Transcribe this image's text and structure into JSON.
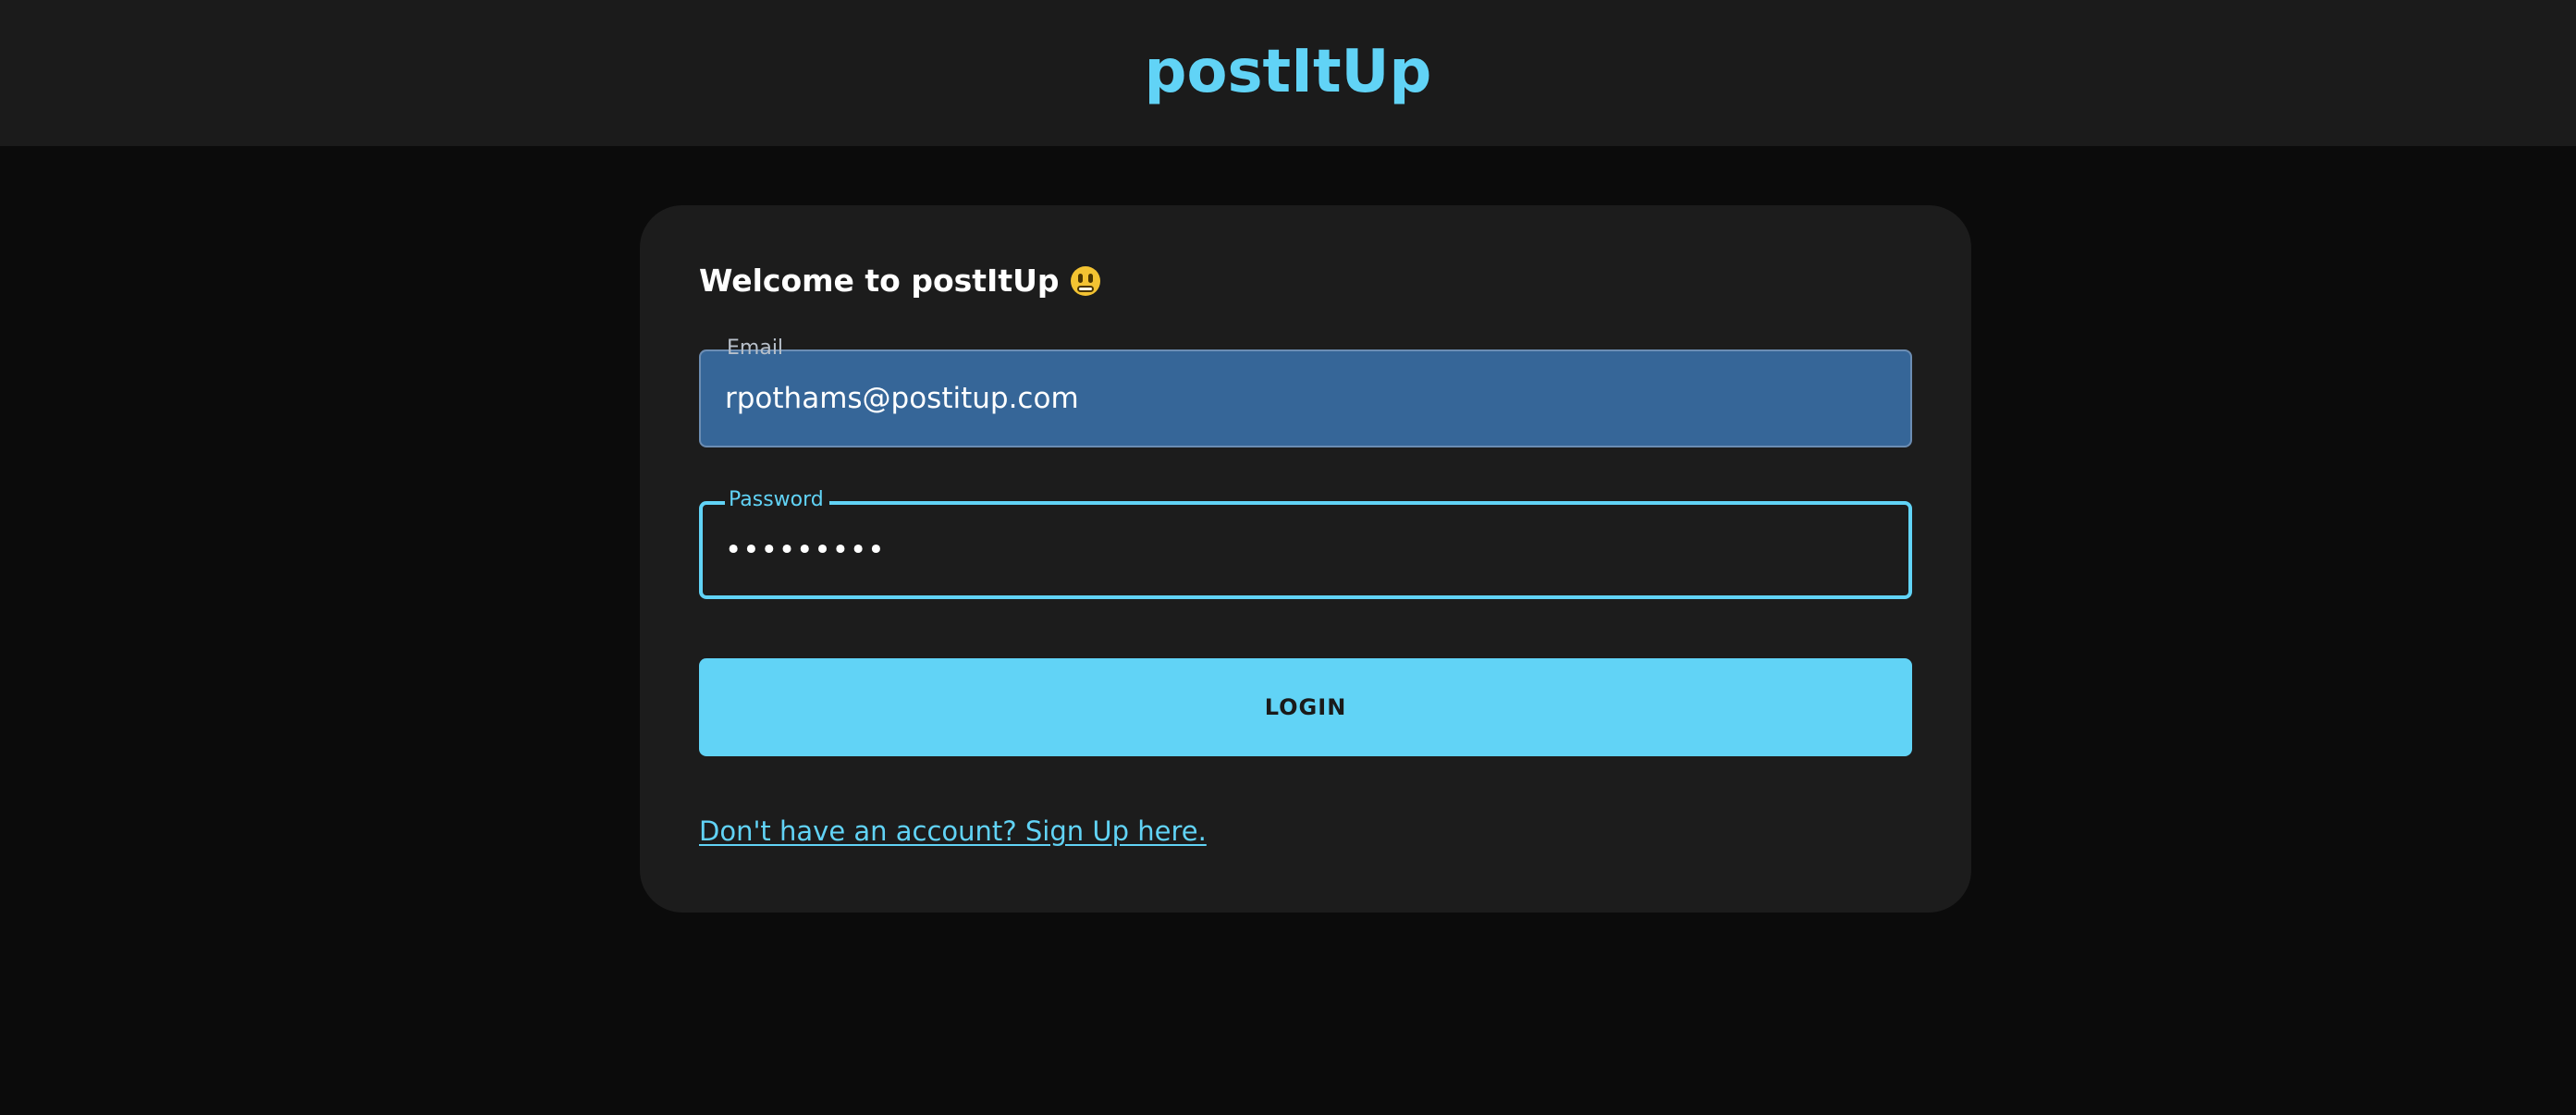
{
  "header": {
    "brand": "postItUp"
  },
  "login_card": {
    "welcome_text": "Welcome to postItUp",
    "emoji_name": "grimacing-face-icon",
    "email": {
      "label": "Email",
      "value": "rpothams@postitup.com"
    },
    "password": {
      "label": "Password",
      "masked_value": "•••••••••"
    },
    "login_button": "LOGIN",
    "signup_link": "Don't have an account? Sign Up here."
  },
  "colors": {
    "accent": "#61d3f6",
    "page_background": "#0b0b0b",
    "topbar_background": "#1b1b1b",
    "card_background": "#1c1c1c",
    "email_autofill_background": "#366698"
  }
}
